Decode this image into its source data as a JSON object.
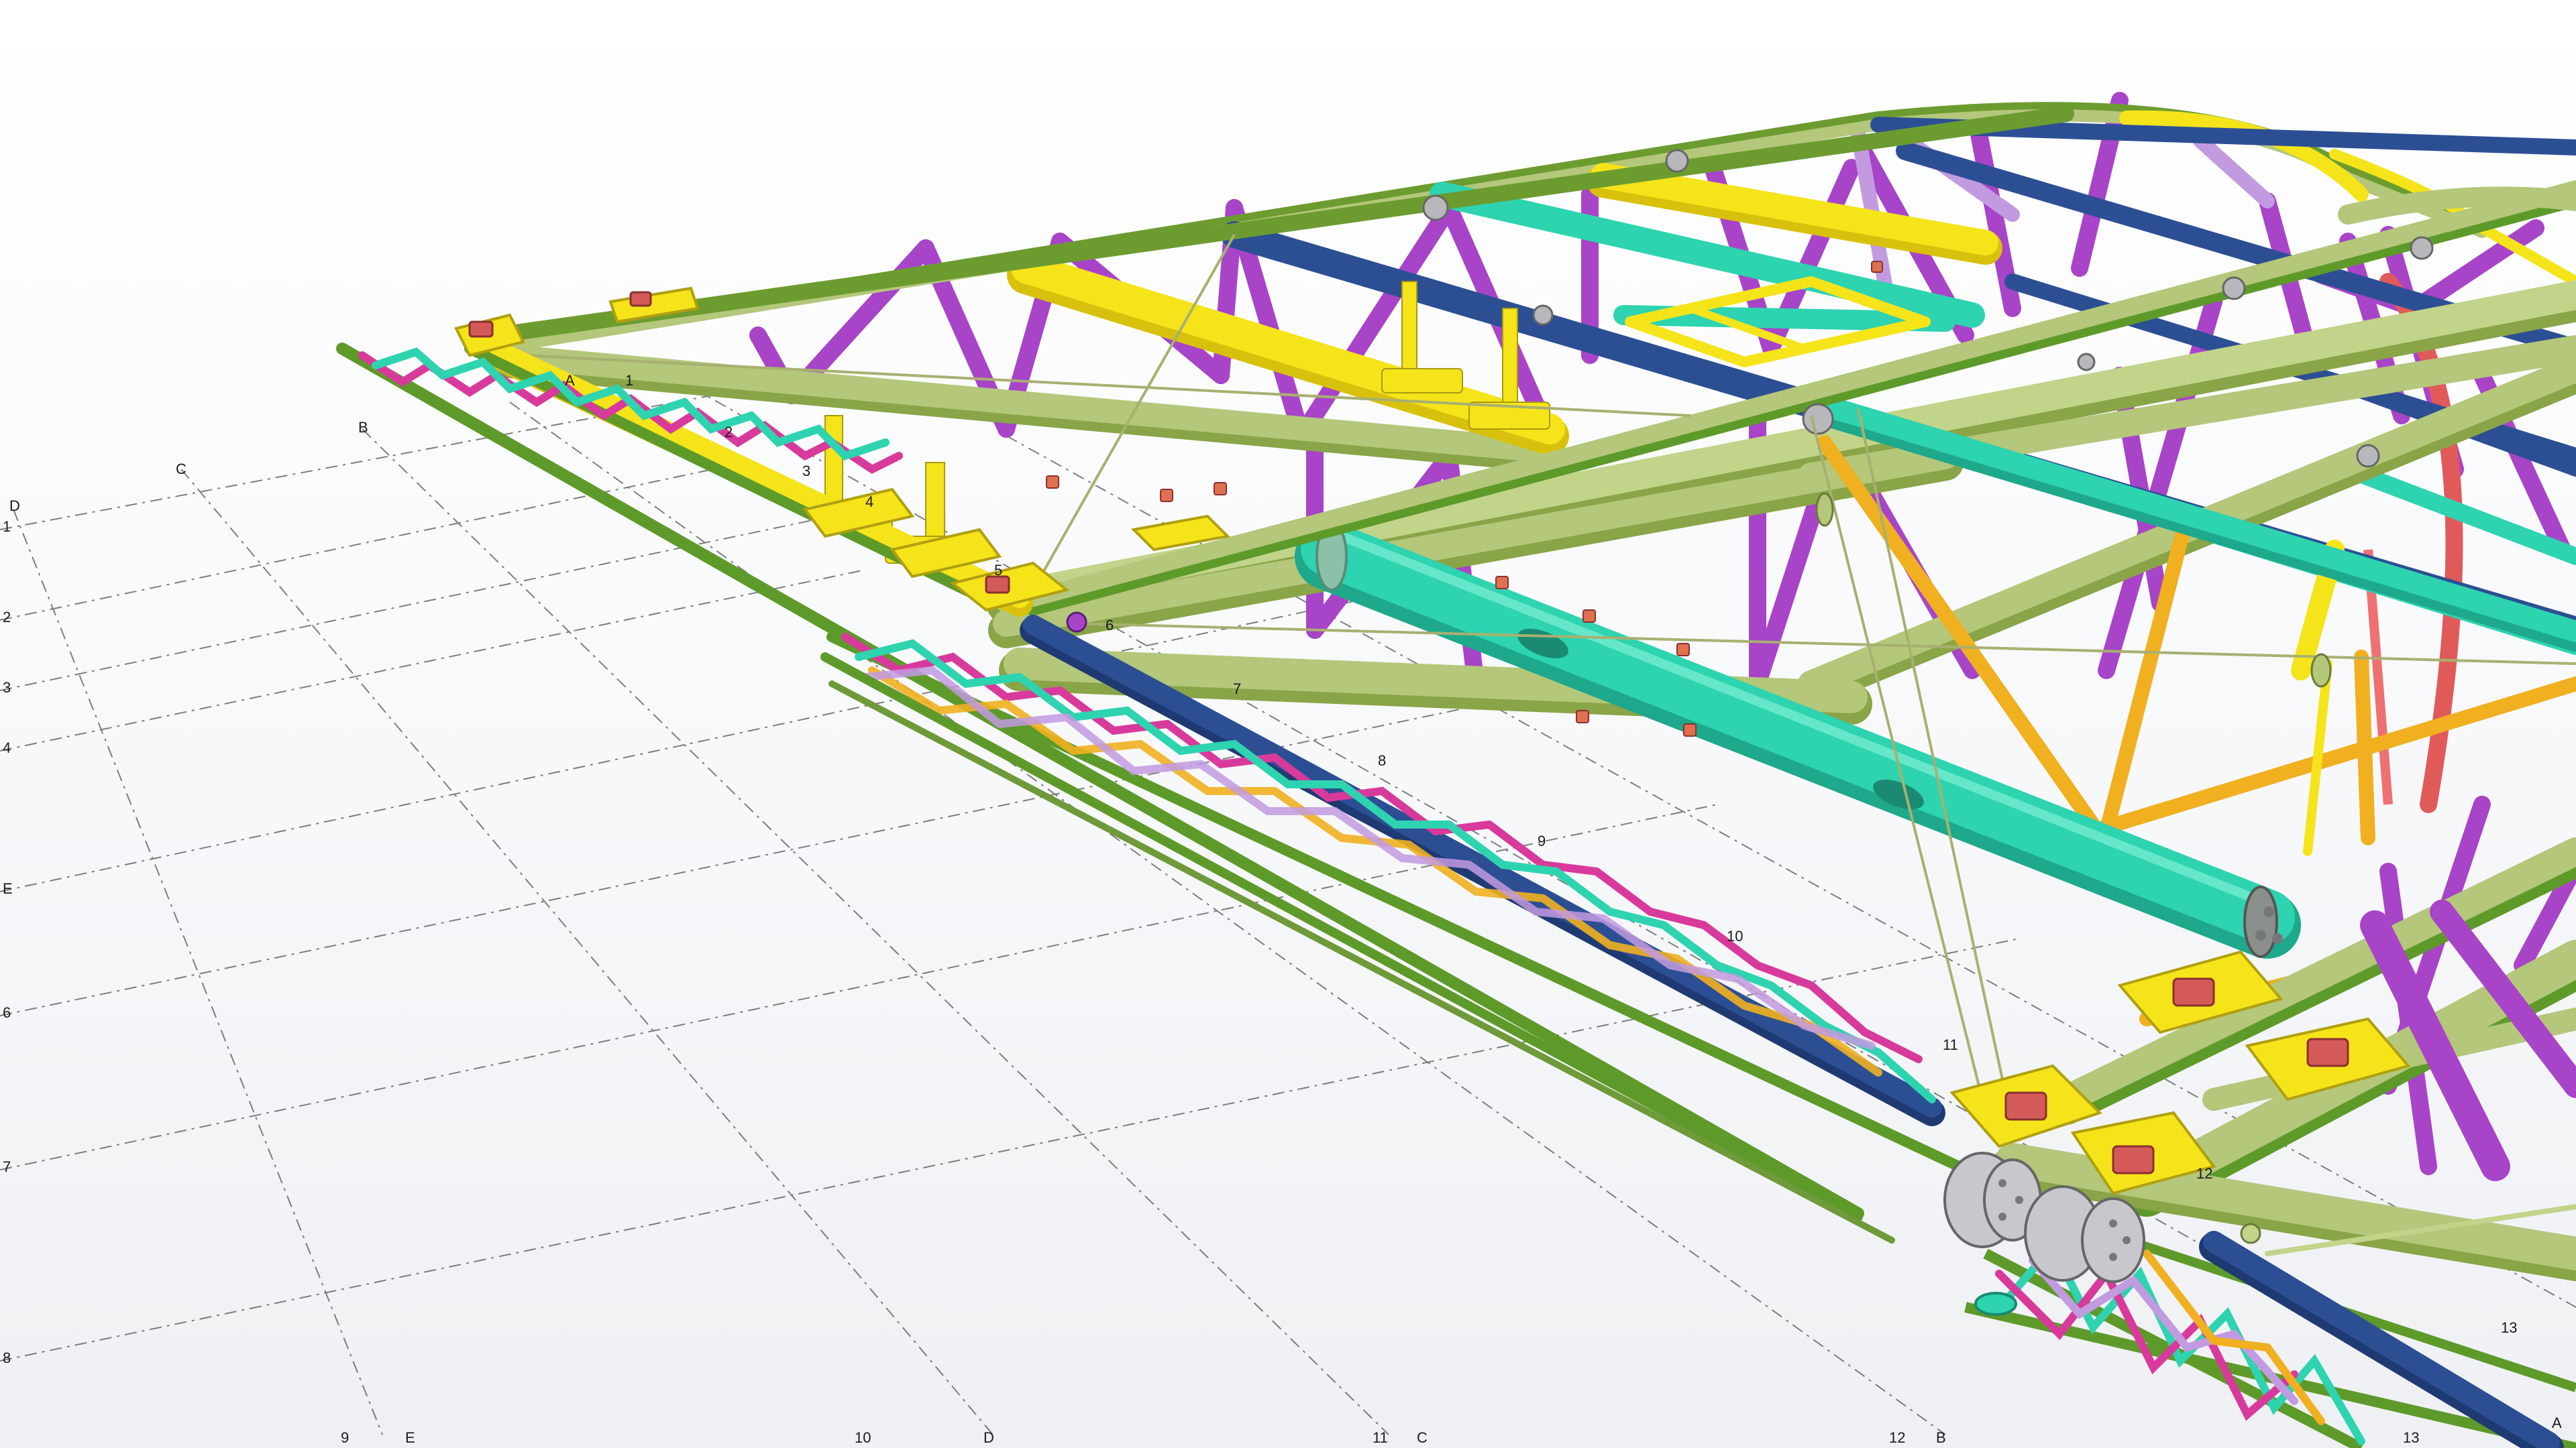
{
  "viewport": {
    "description_colors": {
      "grid_line": "#444444",
      "chord_green": "#b4c77a",
      "edge_green": "#5e9a2a",
      "brace_purple": "#a844c8",
      "beam_blue": "#2c4f94",
      "beam_teal": "#2ed3b0",
      "beam_yellow": "#f5e41a",
      "brace_orange": "#f0b020",
      "brace_magenta": "#d83a9c",
      "arch_red": "#e05a5a",
      "plate_gray": "#c8c8cc",
      "bolt_red": "#d45a5a"
    }
  },
  "grid_axes": {
    "letter_labels": [
      "A",
      "B",
      "C",
      "D",
      "E",
      "E",
      "D",
      "C",
      "B",
      "A"
    ],
    "number_labels": [
      "1",
      "2",
      "3",
      "4",
      "E",
      "6",
      "7",
      "8",
      "9",
      "10",
      "11",
      "12",
      "13"
    ],
    "model_labels": [
      "A",
      "1",
      "2",
      "3",
      "4",
      "5",
      "6",
      "7",
      "8",
      "9",
      "10",
      "11",
      "12",
      "13"
    ],
    "left_edge_labels": [
      "D",
      "1",
      "2",
      "3",
      "4",
      "E",
      "6",
      "7",
      "8"
    ],
    "top_left_labels": [
      "B",
      "C"
    ]
  }
}
